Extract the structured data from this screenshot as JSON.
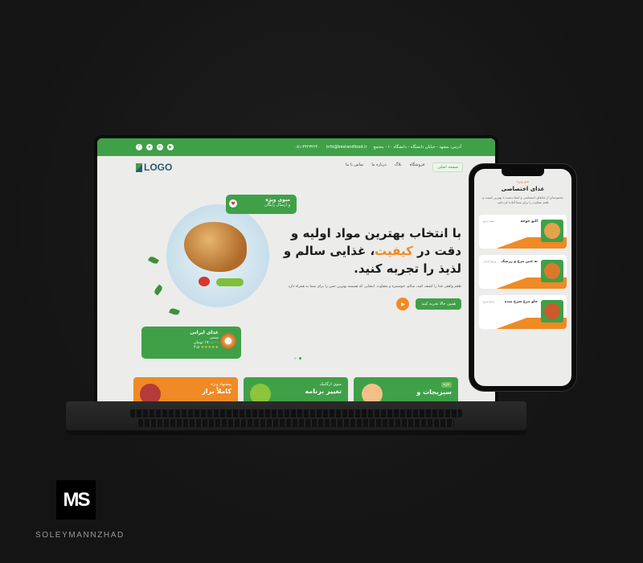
{
  "topbar": {
    "address": "آدرس: مشهد - خیابان دانشگاه - دانشگاه ۱۰ - مجتمع",
    "email": "info@bestandfood.ir",
    "phone": "۰۵۱-۳۴۲۳۴۲۴۰"
  },
  "nav": {
    "logo_text": "LOGO",
    "items": [
      "صفحه اصلی",
      "فروشگاه",
      "بلاگ",
      "درباره ما",
      "تماس با ما"
    ]
  },
  "special": {
    "title": "منوی ویژه",
    "subtitle": "و ارسال رایگان"
  },
  "food_card": {
    "title": "غذای ایرانی",
    "subtitle": "سنتی",
    "price": "۱۷۰،۰۰۰ تومان",
    "rating": "۴.۵",
    "stars": "★★★★★"
  },
  "hero": {
    "title_part1": "با انتخاب بهترین مواد اولیه و دقت در ",
    "title_highlight": "کیفیت",
    "title_part2": "، غذایی سالم و لذیذ را تجربه کنید.",
    "description": "طعم واقعی غذا را کشف کنید، سالم، خوشمزه و متفاوت. اینجایی که همیشه بهترین حس را برای شما به همراه دارد.",
    "cta_label": "همین حالا تجربه کنید",
    "play_icon": "▶"
  },
  "promos": [
    {
      "tag": "پیشنهاد ویژه",
      "title": "کاملاً براز"
    },
    {
      "tag": "منوی ارگانیک",
      "title": "تغییر برنامه"
    },
    {
      "tag": "تازه",
      "title": "سبزیجات و"
    }
  ],
  "phone": {
    "kicker": "منو ویژه",
    "title": "غذای اختصاصی",
    "description": "مجموعه‌ای از غذاهای اختصاصی و انتخاب‌شده با بهترین کیفیت و طعم متفاوت را برای شما آماده کرده‌ایم.",
    "cards": [
      {
        "name": "الیو جوجه",
        "detail": "سینه مرغ",
        "price": "۱۴۰ تومان",
        "color": "#e4a24a"
      },
      {
        "name": "ته چین مرغ و زرشک",
        "detail": "برنج ایرانی",
        "price": "۱۴۰ تومان",
        "color": "#d97a2b"
      },
      {
        "name": "چلو مرغ سرخ شده",
        "detail": "مرغ سرخ",
        "price": "۱۴۰ تومان",
        "color": "#c95b2c"
      }
    ]
  },
  "brand": {
    "logo": "MS",
    "name": "SOLEYMANNZHAD"
  },
  "colors": {
    "green": "#3fa048",
    "orange": "#f08a24",
    "background": "#141414"
  }
}
